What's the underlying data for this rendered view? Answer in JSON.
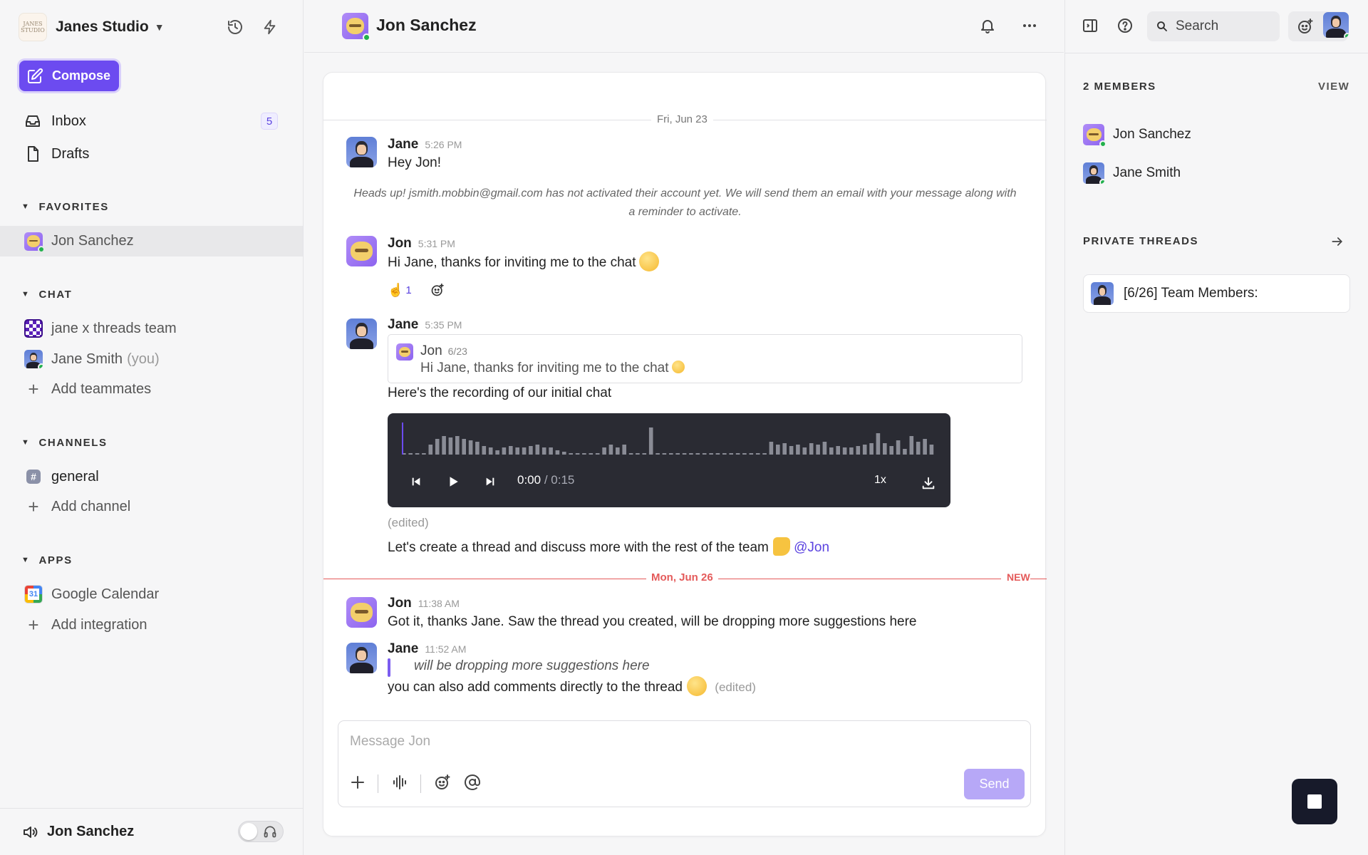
{
  "workspace": {
    "name": "Janes Studio",
    "logo_text": "JANES STUDIO"
  },
  "compose_label": "Compose",
  "nav": [
    {
      "label": "Inbox",
      "badge": "5"
    },
    {
      "label": "Drafts"
    }
  ],
  "sections": {
    "favorites": {
      "title": "FAVORITES",
      "items": [
        {
          "label": "Jon Sanchez"
        }
      ]
    },
    "chat": {
      "title": "CHAT",
      "items": [
        {
          "label": "jane x threads team"
        },
        {
          "label": "Jane Smith",
          "suffix": "(you)"
        }
      ],
      "add_label": "Add teammates"
    },
    "channels": {
      "title": "CHANNELS",
      "items": [
        {
          "label": "general",
          "icon_text": "#"
        }
      ],
      "add_label": "Add channel"
    },
    "apps": {
      "title": "APPS",
      "items": [
        {
          "label": "Google Calendar",
          "icon_text": "31"
        }
      ],
      "add_label": "Add integration"
    }
  },
  "bottom_bar": {
    "user": "Jon Sanchez"
  },
  "header": {
    "title": "Jon Sanchez"
  },
  "conversation": {
    "date1": "Fri, Jun 23",
    "m1": {
      "name": "Jane",
      "time": "5:26 PM",
      "text": "Hey Jon!"
    },
    "notice": "Heads up! jsmith.mobbin@gmail.com has not activated their account yet. We will send them an email with your message along with a reminder to activate.",
    "m2": {
      "name": "Jon",
      "time": "5:31 PM",
      "text": "Hi Jane, thanks for inviting me to the chat",
      "reaction_count": "1"
    },
    "m3": {
      "name": "Jane",
      "time": "5:35 PM",
      "quote": {
        "name": "Jon",
        "date": "6/23",
        "text": "Hi Jane, thanks for inviting me to the chat"
      },
      "text": "Here's the recording of our initial chat",
      "audio": {
        "current": "0:00",
        "duration": "/ 0:15",
        "speed": "1x",
        "progress": 0
      },
      "edited": "(edited)",
      "text2": "Let's create a thread and discuss more with the rest of the team",
      "mention": "@Jon"
    },
    "date2": "Mon, Jun 26",
    "new_tag": "NEW",
    "m4": {
      "name": "Jon",
      "time": "11:38 AM",
      "text": "Got it, thanks Jane. Saw the thread you created, will be dropping more suggestions here"
    },
    "m5": {
      "name": "Jane",
      "time": "11:52 AM",
      "quote": "will be dropping more suggestions here",
      "text": "you can also add comments directly to the thread",
      "edited": "(edited)"
    }
  },
  "composer": {
    "placeholder": "Message Jon",
    "send": "Send"
  },
  "right_panel": {
    "search_label": "Search",
    "members_title": "2 MEMBERS",
    "view_label": "VIEW",
    "members": [
      {
        "name": "Jon Sanchez"
      },
      {
        "name": "Jane Smith"
      }
    ],
    "threads_title": "PRIVATE THREADS",
    "thread": "[6/26] Team Members:"
  },
  "colors": {
    "accent": "#6c4bf0",
    "new_marker": "#e45a5a",
    "online": "#22b14c"
  }
}
